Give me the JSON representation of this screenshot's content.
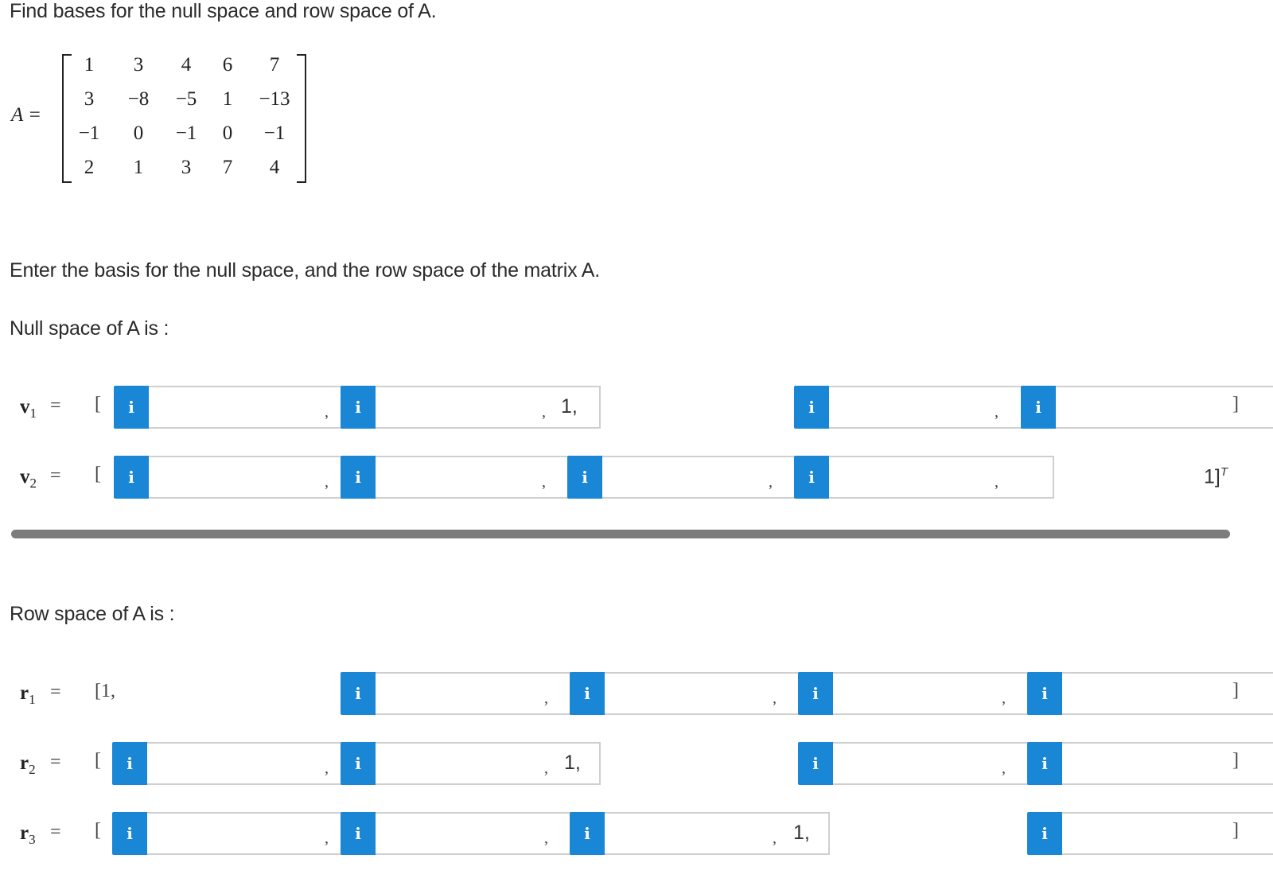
{
  "question": "Find bases for the null space and row space of A.",
  "matrix": {
    "label": "A =",
    "rows": [
      [
        "1",
        "3",
        "4",
        "6",
        "7"
      ],
      [
        "3",
        "−8",
        "−5",
        "1",
        "−13"
      ],
      [
        "−1",
        "0",
        "−1",
        "0",
        "−1"
      ],
      [
        "2",
        "1",
        "3",
        "7",
        "4"
      ]
    ]
  },
  "instruction": "Enter the basis for the null space, and the row space of the matrix A.",
  "null_space": {
    "heading": "Null space of A is :",
    "v1": {
      "name": "v",
      "sub": "1",
      "eq": "=",
      "open": "[",
      "fixed": "1,",
      "close": "]"
    },
    "v2": {
      "name": "v",
      "sub": "2",
      "eq": "=",
      "open": "[",
      "fixed": "1]",
      "sup": "T"
    }
  },
  "row_space": {
    "heading": "Row space of A is :",
    "r1": {
      "name": "r",
      "sub": "1",
      "eq": "=",
      "open": "[1,",
      "close": "]"
    },
    "r2": {
      "name": "r",
      "sub": "2",
      "eq": "=",
      "open": "[",
      "fixed": "1,",
      "close": "]"
    },
    "r3": {
      "name": "r",
      "sub": "3",
      "eq": "=",
      "open": "[",
      "fixed": "1,",
      "close": "]"
    }
  },
  "info_icon": "i",
  "comma": ",",
  "colors": {
    "info": "#1a86d6",
    "separator": "#7c7c7c"
  }
}
